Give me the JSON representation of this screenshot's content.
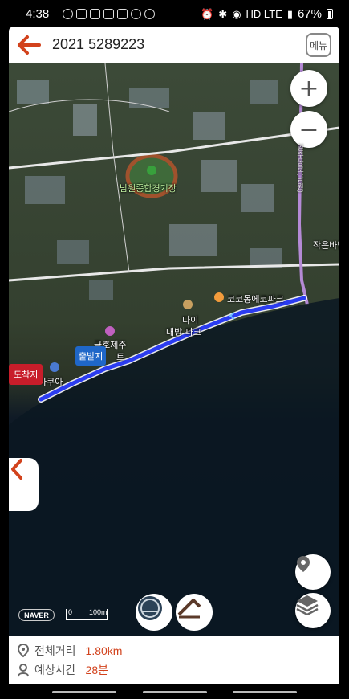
{
  "status_bar": {
    "time": "4:38",
    "network": "HD LTE",
    "battery": "67%"
  },
  "header": {
    "title": "2021 5289223",
    "menu_label": "메뉴"
  },
  "map": {
    "zoom_in": "+",
    "zoom_out": "−",
    "labels": {
      "stadium": "남원종합경기장",
      "road": "일주동로(남원)",
      "small_stream": "작은바당",
      "kokomong": "코코몽에코파크",
      "daibang_1": "다이",
      "daibang_2": "대방  파크",
      "geukho_1": "극호제주",
      "geukho_2": "트",
      "aquarium": "아쿠아"
    },
    "start_label": "출발지",
    "end_label": "도착지",
    "logo": "NAVER",
    "scale_start": "0",
    "scale_end": "100m"
  },
  "info": {
    "distance_label": "전체거리",
    "distance_value": "1.80km",
    "time_label": "예상시간",
    "time_value": "28분"
  },
  "colors": {
    "accent": "#d2421c",
    "route": "#2b3cf0",
    "start": "#1f67c8",
    "end": "#c81d2a"
  }
}
